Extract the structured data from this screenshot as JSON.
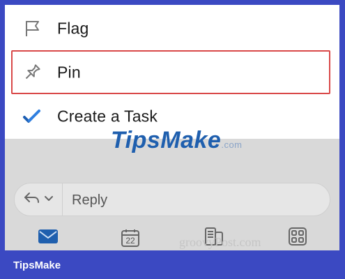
{
  "menu": {
    "items": [
      {
        "label": "Flag",
        "icon": "flag-icon"
      },
      {
        "label": "Pin",
        "icon": "pin-icon"
      },
      {
        "label": "Create a Task",
        "icon": "task-check-icon"
      }
    ],
    "highlight_color": "#d94848"
  },
  "watermark": {
    "text": "TipsMake",
    "suffix": ".com"
  },
  "reply_bar": {
    "label": "Reply",
    "icons": [
      "reply-arrow-icon",
      "chevron-down-icon"
    ]
  },
  "tabbar": {
    "tabs": [
      {
        "icon": "mail-icon",
        "active": true
      },
      {
        "icon": "calendar-icon",
        "text": "22"
      },
      {
        "icon": "files-icon"
      },
      {
        "icon": "apps-grid-icon"
      }
    ],
    "active_color": "#1f5fae"
  },
  "credit": {
    "text": "groovyPost.com"
  },
  "footer": {
    "brand": "TipsMake"
  },
  "colors": {
    "frame": "#3b49c2",
    "menu_bg": "#ffffff",
    "overlay": "#d9d9d9"
  }
}
